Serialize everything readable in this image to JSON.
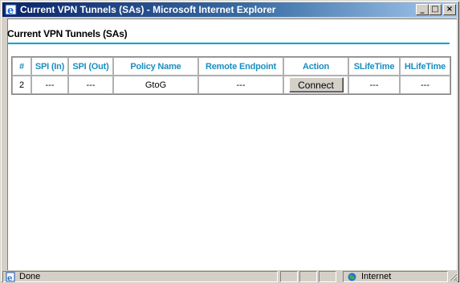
{
  "window": {
    "title": "Current VPN Tunnels (SAs) - Microsoft Internet Explorer",
    "minimize_glyph": "_",
    "maximize_glyph": "□",
    "close_glyph": "×"
  },
  "page": {
    "heading": "Current VPN Tunnels (SAs)",
    "accent_color": "#00a0d0"
  },
  "table": {
    "headers": [
      "#",
      "SPI (In)",
      "SPI (Out)",
      "Policy Name",
      "Remote Endpoint",
      "Action",
      "SLifeTime",
      "HLifeTime"
    ],
    "rows": [
      {
        "num": "2",
        "spi_in": "---",
        "spi_out": "---",
        "policy_name": "GtoG",
        "remote_endpoint": "---",
        "action_label": "Connect",
        "slifetime": "---",
        "hlifetime": "---"
      }
    ]
  },
  "statusbar": {
    "status_text": "Done",
    "zone_text": "Internet",
    "status_icon": "ie-page-icon",
    "zone_icon": "internet-globe-icon"
  }
}
